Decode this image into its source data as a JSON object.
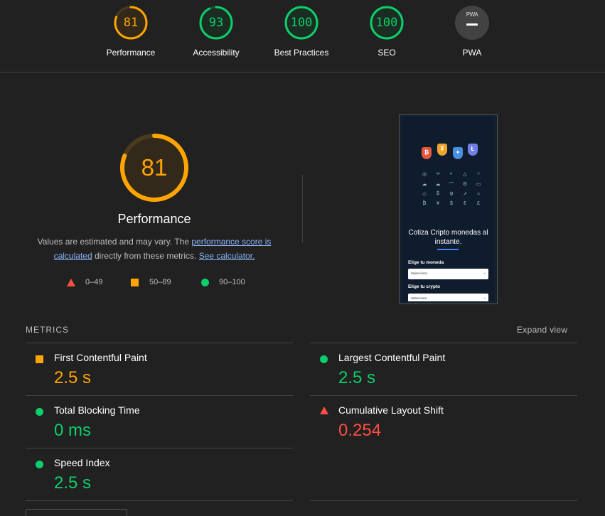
{
  "summary": {
    "gauges": [
      {
        "label": "Performance",
        "score": "81",
        "color": "#ffa400",
        "value": 0.81
      },
      {
        "label": "Accessibility",
        "score": "93",
        "color": "#0cce6b",
        "value": 0.93
      },
      {
        "label": "Best Practices",
        "score": "100",
        "color": "#0cce6b",
        "value": 1.0
      },
      {
        "label": "SEO",
        "score": "100",
        "color": "#0cce6b",
        "value": 1.0
      }
    ],
    "pwa": {
      "label": "PWA",
      "badge": "PWA"
    }
  },
  "performance": {
    "score": "81",
    "value": 0.81,
    "title": "Performance",
    "desc_prefix": "Values are estimated and may vary. The ",
    "desc_link1": "performance score is calculated",
    "desc_mid": " directly from these metrics. ",
    "desc_link2": "See calculator."
  },
  "legend": {
    "fail": "0–49",
    "average": "50–89",
    "pass": "90–100"
  },
  "screenshot": {
    "title": "Cotiza Cripto monedas al instante.",
    "label1": "Elige tu moneda",
    "select1": "Selecciona :",
    "label2": "Elige tu crypto",
    "select2": "Selecciona",
    "coins": [
      "₿",
      "₮",
      "✦",
      "Ł"
    ]
  },
  "metrics": {
    "header": "METRICS",
    "expand": "Expand view",
    "items": [
      {
        "name": "First Contentful Paint",
        "value": "2.5 s",
        "status": "average"
      },
      {
        "name": "Largest Contentful Paint",
        "value": "2.5 s",
        "status": "pass"
      },
      {
        "name": "Total Blocking Time",
        "value": "0 ms",
        "status": "pass"
      },
      {
        "name": "Cumulative Layout Shift",
        "value": "0.254",
        "status": "fail"
      },
      {
        "name": "Speed Index",
        "value": "2.5 s",
        "status": "pass"
      }
    ]
  },
  "colors": {
    "pass": "#0cce6b",
    "average": "#ffa400",
    "fail": "#ff4e42"
  }
}
